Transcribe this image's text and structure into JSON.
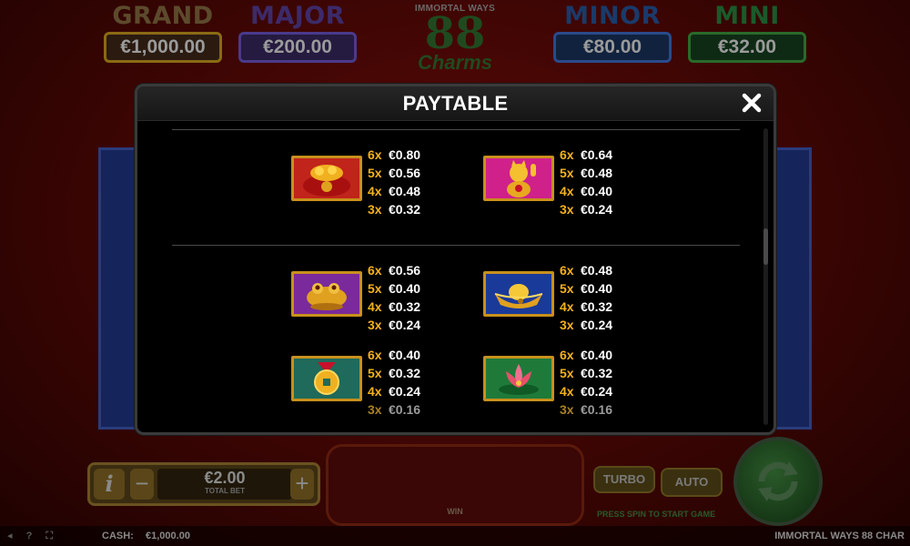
{
  "jackpots": [
    {
      "name": "GRAND",
      "value": "€1,000.00"
    },
    {
      "name": "MAJOR",
      "value": "€200.00"
    },
    {
      "name": "MINOR",
      "value": "€80.00"
    },
    {
      "name": "MINI",
      "value": "€32.00"
    }
  ],
  "logo": {
    "top": "IMMORTAL WAYS",
    "main": "88",
    "sub": "Charms"
  },
  "bet": {
    "value": "€2.00",
    "label": "TOTAL BET",
    "info": "i",
    "minus": "−",
    "plus": "+"
  },
  "win_label": "WIN",
  "buttons": {
    "turbo": "TURBO",
    "auto": "AUTO"
  },
  "press_message": "PRESS SPIN TO START GAME",
  "status": {
    "cash_label": "CASH:",
    "cash_value": "€1,000.00",
    "game_title": "IMMORTAL WAYS 88 CHAR"
  },
  "modal": {
    "title": "PAYTABLE",
    "close_icon": "close-icon",
    "scroll_position": 0.34,
    "symbols": [
      {
        "icon": "gold-bag-icon",
        "bg": "#c0241a",
        "pays": [
          {
            "count": "6x",
            "amount": "€0.80"
          },
          {
            "count": "5x",
            "amount": "€0.56"
          },
          {
            "count": "4x",
            "amount": "€0.48"
          },
          {
            "count": "3x",
            "amount": "€0.32"
          }
        ]
      },
      {
        "icon": "lucky-cat-icon",
        "bg": "#d0208a",
        "pays": [
          {
            "count": "6x",
            "amount": "€0.64"
          },
          {
            "count": "5x",
            "amount": "€0.48"
          },
          {
            "count": "4x",
            "amount": "€0.40"
          },
          {
            "count": "3x",
            "amount": "€0.24"
          }
        ]
      },
      {
        "icon": "golden-toad-icon",
        "bg": "#7a2a9a",
        "pays": [
          {
            "count": "6x",
            "amount": "€0.56"
          },
          {
            "count": "5x",
            "amount": "€0.40"
          },
          {
            "count": "4x",
            "amount": "€0.32"
          },
          {
            "count": "3x",
            "amount": "€0.24"
          }
        ]
      },
      {
        "icon": "gold-ingot-icon",
        "bg": "#1a3a9a",
        "pays": [
          {
            "count": "6x",
            "amount": "€0.48"
          },
          {
            "count": "5x",
            "amount": "€0.40"
          },
          {
            "count": "4x",
            "amount": "€0.32"
          },
          {
            "count": "3x",
            "amount": "€0.24"
          }
        ]
      },
      {
        "icon": "gold-coin-icon",
        "bg": "#1f6a5a",
        "pays": [
          {
            "count": "6x",
            "amount": "€0.40"
          },
          {
            "count": "5x",
            "amount": "€0.32"
          },
          {
            "count": "4x",
            "amount": "€0.24"
          },
          {
            "count": "3x",
            "amount": "€0.16"
          }
        ]
      },
      {
        "icon": "lotus-flower-icon",
        "bg": "#1f7a3a",
        "pays": [
          {
            "count": "6x",
            "amount": "€0.40"
          },
          {
            "count": "5x",
            "amount": "€0.32"
          },
          {
            "count": "4x",
            "amount": "€0.24"
          },
          {
            "count": "3x",
            "amount": "€0.16"
          }
        ]
      }
    ]
  }
}
